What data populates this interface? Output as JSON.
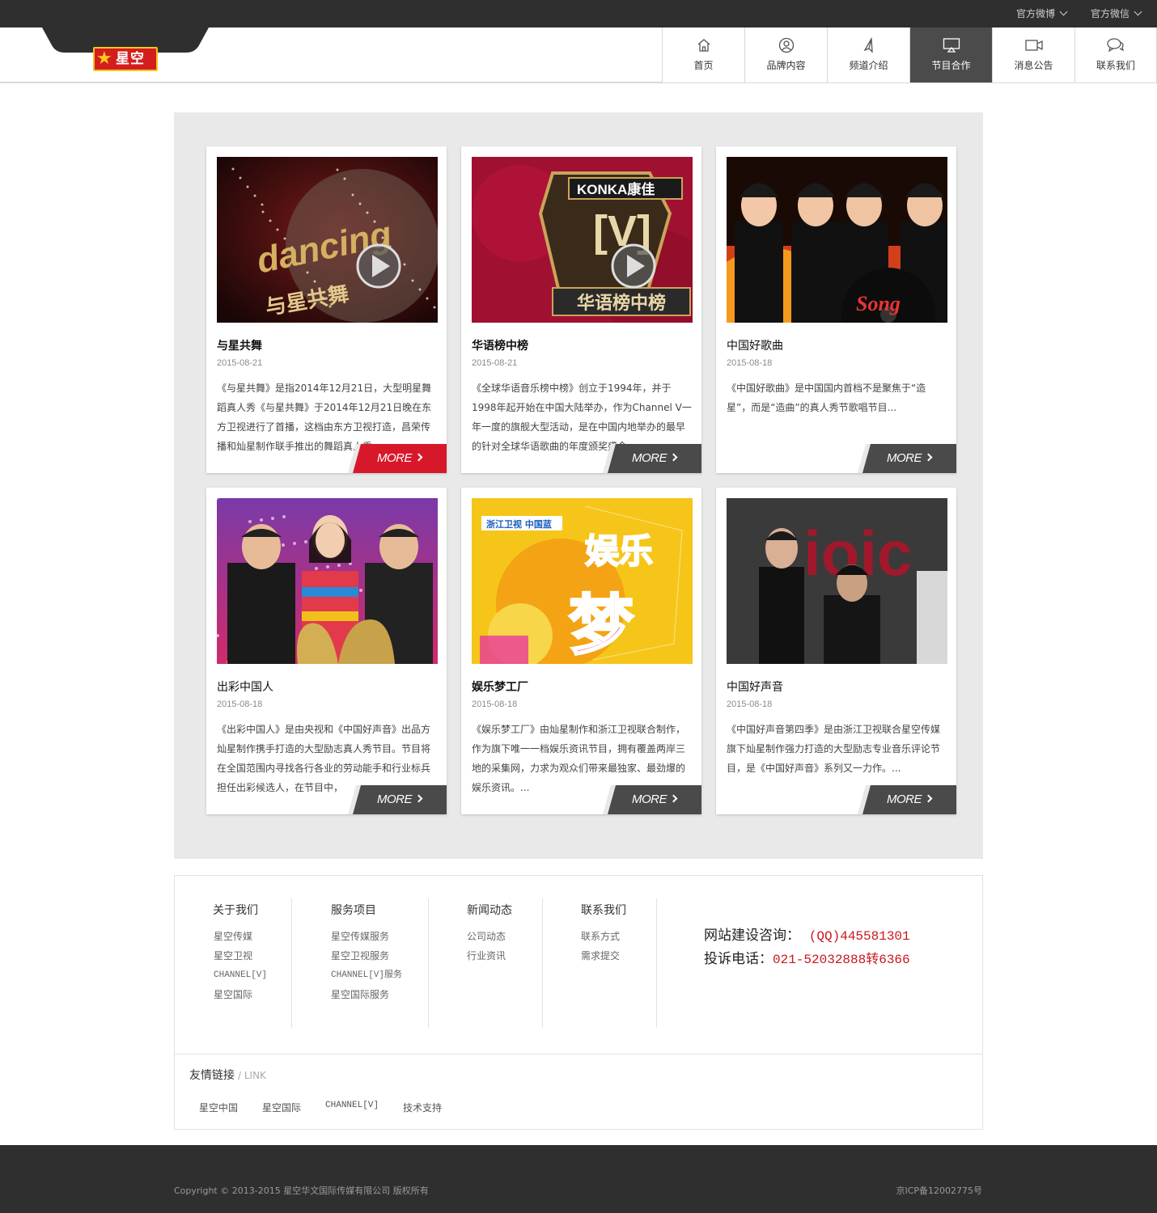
{
  "topbar": {
    "weibo": "官方微博",
    "weixin": "官方微信"
  },
  "logo": {
    "text": "星空"
  },
  "nav": [
    {
      "label": "首页",
      "icon": "home-icon",
      "active": false
    },
    {
      "label": "品牌内容",
      "icon": "user-icon",
      "active": false
    },
    {
      "label": "频道介绍",
      "icon": "paper-plane-icon",
      "active": false
    },
    {
      "label": "节目合作",
      "icon": "airplay-icon",
      "active": true
    },
    {
      "label": "消息公告",
      "icon": "video-camera-icon",
      "active": false
    },
    {
      "label": "联系我们",
      "icon": "chat-icon",
      "active": false
    }
  ],
  "more_label": "MORE",
  "cards": [
    {
      "title": "与星共舞",
      "date": "2015-08-21",
      "desc": "《与星共舞》是指2014年12月21日，大型明星舞蹈真人秀《与星共舞》于2014年12月21日晚在东方卫视进行了首播，这档由东方卫视打造，昌荣传播和灿星制作联手推出的舞蹈真人秀",
      "more_active": true,
      "thumb_text": "dancing with the stars",
      "thumb_sub": "与星共舞",
      "has_play": true
    },
    {
      "title": "华语榜中榜",
      "date": "2015-08-21",
      "desc": "《全球华语音乐榜中榜》创立于1994年，并于1998年起开始在中国大陆举办，作为Channel V一年一度的旗舰大型活动，是在中国内地举办的最早的针对全球华语歌曲的年度颁奖盛会。",
      "more_active": false,
      "thumb_text": "KONKA康佳",
      "thumb_sub": "华语榜中榜",
      "has_play": true
    },
    {
      "title": "中国好歌曲",
      "date": "2015-08-18",
      "desc": "《中国好歌曲》是中国国内首档不是聚焦于“造星”，而是“造曲”的真人秀节歌唱节目...",
      "more_active": false,
      "thumb_text": "Sing My Song",
      "thumb_sub": "",
      "has_play": false
    },
    {
      "title": "出彩中国人",
      "date": "2015-08-18",
      "desc": "《出彩中国人》是由央视和《中国好声音》出品方灿星制作携手打造的大型励志真人秀节目。节目将在全国范围内寻找各行各业的劳动能手和行业标兵担任出彩候选人，在节目中，",
      "more_active": false,
      "thumb_text": "",
      "thumb_sub": "",
      "has_play": false
    },
    {
      "title": "娱乐梦工厂",
      "date": "2015-08-18",
      "desc": "《娱乐梦工厂》由灿星制作和浙江卫视联合制作，作为旗下唯一一档娱乐资讯节目，拥有覆盖两岸三地的采集网，力求为观众们带来最独家、最劲爆的娱乐资讯。...",
      "more_active": false,
      "thumb_text": "娱乐梦",
      "thumb_sub": "浙江卫视 中国蓝",
      "has_play": false
    },
    {
      "title": "中国好声音",
      "date": "2015-08-18",
      "desc": "《中国好声音第四季》是由浙江卫视联合星空传媒旗下灿星制作强力打造的大型励志专业音乐评论节目，是《中国好声音》系列又一力作。...",
      "more_active": false,
      "thumb_text": "Voice",
      "thumb_sub": "",
      "has_play": false
    }
  ],
  "footer": {
    "cols": [
      {
        "title": "关于我们",
        "items": [
          "星空传媒",
          "星空卫视",
          "CHANNEL[V]",
          "星空国际"
        ]
      },
      {
        "title": "服务项目",
        "items": [
          "星空传媒服务",
          "星空卫视服务",
          "CHANNEL[V]服务",
          "星空国际服务"
        ]
      },
      {
        "title": "新闻动态",
        "items": [
          "公司动态",
          "行业资讯"
        ]
      },
      {
        "title": "联系我们",
        "items": [
          "联系方式",
          "需求提交"
        ]
      }
    ],
    "consult_label": "网站建设咨询：",
    "consult_value": "(QQ)445581301",
    "complain_label": "投诉电话：",
    "complain_value": "021-52032888转6366",
    "friend_title": "友情链接",
    "friend_sub": "/ LINK",
    "friend_links": [
      "星空中国",
      "星空国际",
      "CHANNEL[V]",
      "技术支持"
    ]
  },
  "bottom": {
    "copyright": "Copyright © 2013-2015 星空华文国际传媒有限公司 版权所有",
    "icp": "京ICP备12002775号"
  },
  "colors": {
    "accent_red": "#d7182a",
    "dark": "#2f2f2f",
    "more_dark": "#4a4a4a"
  }
}
